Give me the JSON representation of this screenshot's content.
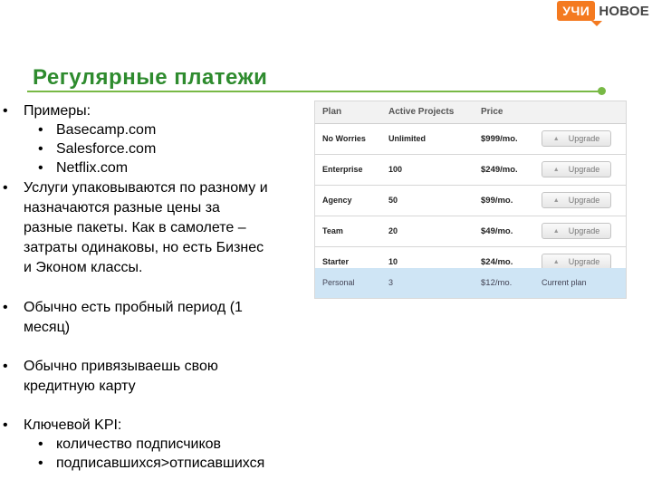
{
  "logo": {
    "box_text": "УЧИ",
    "text": "НОВОЕ",
    "color": "#f47a20"
  },
  "slide": {
    "title": "Регулярные платежи",
    "accent_color": "#78b945",
    "title_color": "#2e8b2e"
  },
  "bullets": {
    "examples_label": "Примеры:",
    "examples": [
      "Basecamp.com",
      "Salesforce.com",
      "Netflix.com"
    ],
    "packaging": [
      "Услуги упаковываются по разному и",
      "назначаются разные цены за",
      "разные пакеты. Как в самолете –",
      "затраты одинаковы, но есть Бизнес",
      "и Эконом классы."
    ],
    "trial": [
      "Обычно есть пробный период (1",
      "месяц)"
    ],
    "card": [
      "Обычно привязываешь свою",
      "кредитную карту"
    ],
    "kpi_label": "Ключевой KPI:",
    "kpi_items": [
      "количество подписчиков",
      "подписавшихся>отписавшихся"
    ]
  },
  "pricing": {
    "headers": {
      "plan": "Plan",
      "projects": "Active Projects",
      "price": "Price"
    },
    "button_label": "Upgrade",
    "current_label": "Current plan",
    "rows": [
      {
        "plan": "No Worries",
        "projects": "Unlimited",
        "price": "$999/mo."
      },
      {
        "plan": "Enterprise",
        "projects": "100",
        "price": "$249/mo."
      },
      {
        "plan": "Agency",
        "projects": "50",
        "price": "$99/mo."
      },
      {
        "plan": "Team",
        "projects": "20",
        "price": "$49/mo."
      },
      {
        "plan": "Starter",
        "projects": "10",
        "price": "$24/mo."
      }
    ],
    "current": {
      "plan": "Personal",
      "projects": "3",
      "price": "$12/mo."
    }
  }
}
